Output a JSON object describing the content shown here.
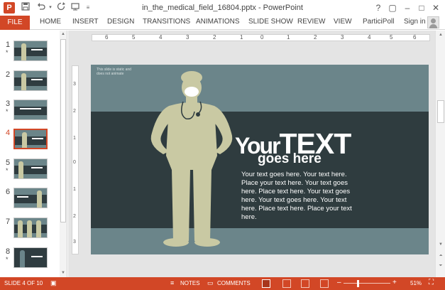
{
  "titlebar": {
    "app_icon": "P",
    "save_icon": "save-icon",
    "undo_icon": "undo-icon",
    "redo_icon": "redo-icon",
    "start_icon": "start-from-beginning-icon",
    "title": "in_the_medical_field_16804.pptx - PowerPoint",
    "help": "?",
    "restore": "▢",
    "minimize": "–",
    "maximize": "□",
    "close": "✕"
  },
  "ribbon": {
    "tabs": [
      "FILE",
      "HOME",
      "INSERT",
      "DESIGN",
      "TRANSITIONS",
      "ANIMATIONS",
      "SLIDE SHOW",
      "REVIEW",
      "VIEW",
      "ParticiPoll"
    ],
    "signin": "Sign in"
  },
  "thumbnails": [
    {
      "number": "1",
      "star": "*"
    },
    {
      "number": "2",
      "star": ""
    },
    {
      "number": "3",
      "star": "*"
    },
    {
      "number": "4",
      "star": "",
      "active": true
    },
    {
      "number": "5",
      "star": "*"
    },
    {
      "number": "6",
      "star": ""
    },
    {
      "number": "7",
      "star": ""
    },
    {
      "number": "8",
      "star": "*"
    }
  ],
  "ruler_top": [
    "6",
    "5",
    "4",
    "3",
    "2",
    "1",
    "0",
    "1",
    "2",
    "3",
    "4",
    "5",
    "6"
  ],
  "ruler_left": [
    "3",
    "2",
    "1",
    "0",
    "1",
    "2",
    "3"
  ],
  "slide": {
    "note": "This slide is static and does not animate",
    "headline_your": "Your",
    "headline_text": "TEXT",
    "subhead": "goes here",
    "body": "Your text goes here. Your text here. Place your text here. Your text goes here. Place text here. Your text goes here. Your text goes here. Your text here. Place text here. Place your text here.",
    "colors": {
      "background": "#6b858a",
      "band": "#2f3c3f",
      "figure": "#c9c9a3",
      "text": "#ffffff"
    }
  },
  "statusbar": {
    "slide_info": "SLIDE 4 OF 10",
    "notes": "NOTES",
    "comments": "COMMENTS",
    "zoom_minus": "–",
    "zoom_plus": "+",
    "zoom": "51%",
    "zoom_fraction": 0.3
  },
  "theme": {
    "accent": "#d24726"
  }
}
